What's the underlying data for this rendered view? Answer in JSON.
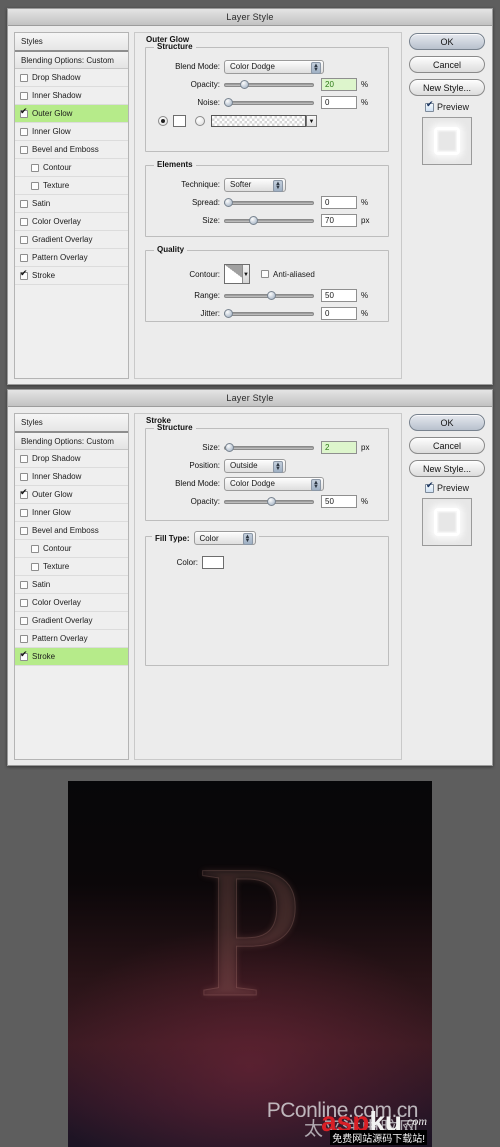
{
  "window": {
    "background_color": "#5e5e5e"
  },
  "dialogs": [
    {
      "title": "Layer Style",
      "styles_panel": {
        "header": "Styles",
        "blending_options": "Blending Options: Custom",
        "items": [
          {
            "label": "Drop Shadow",
            "checked": false,
            "selected": false,
            "indent": false
          },
          {
            "label": "Inner Shadow",
            "checked": false,
            "selected": false,
            "indent": false
          },
          {
            "label": "Outer Glow",
            "checked": true,
            "selected": true,
            "indent": false
          },
          {
            "label": "Inner Glow",
            "checked": false,
            "selected": false,
            "indent": false
          },
          {
            "label": "Bevel and Emboss",
            "checked": false,
            "selected": false,
            "indent": false
          },
          {
            "label": "Contour",
            "checked": false,
            "selected": false,
            "indent": true
          },
          {
            "label": "Texture",
            "checked": false,
            "selected": false,
            "indent": true
          },
          {
            "label": "Satin",
            "checked": false,
            "selected": false,
            "indent": false
          },
          {
            "label": "Color Overlay",
            "checked": false,
            "selected": false,
            "indent": false
          },
          {
            "label": "Gradient Overlay",
            "checked": false,
            "selected": false,
            "indent": false
          },
          {
            "label": "Pattern Overlay",
            "checked": false,
            "selected": false,
            "indent": false
          },
          {
            "label": "Stroke",
            "checked": true,
            "selected": false,
            "indent": false
          }
        ]
      },
      "panel_title": "Outer Glow",
      "groups": {
        "structure": {
          "title": "Structure",
          "blend_mode_label": "Blend Mode:",
          "blend_mode_value": "Color Dodge",
          "opacity_label": "Opacity:",
          "opacity_value": "20",
          "opacity_unit": "%",
          "opacity_percent": 20,
          "noise_label": "Noise:",
          "noise_value": "0",
          "noise_unit": "%",
          "noise_percent": 0,
          "fill_mode": "color",
          "color_swatch": "#ffffff"
        },
        "elements": {
          "title": "Elements",
          "technique_label": "Technique:",
          "technique_value": "Softer",
          "spread_label": "Spread:",
          "spread_value": "0",
          "spread_unit": "%",
          "spread_percent": 0,
          "size_label": "Size:",
          "size_value": "70",
          "size_unit": "px",
          "size_percent": 28
        },
        "quality": {
          "title": "Quality",
          "contour_label": "Contour:",
          "anti_aliased_label": "Anti-aliased",
          "anti_aliased_checked": false,
          "range_label": "Range:",
          "range_value": "50",
          "range_unit": "%",
          "range_percent": 50,
          "jitter_label": "Jitter:",
          "jitter_value": "0",
          "jitter_unit": "%",
          "jitter_percent": 0
        }
      },
      "buttons": {
        "ok": "OK",
        "cancel": "Cancel",
        "new_style": "New Style...",
        "preview": "Preview",
        "preview_checked": true
      }
    },
    {
      "title": "Layer Style",
      "styles_panel": {
        "header": "Styles",
        "blending_options": "Blending Options: Custom",
        "items": [
          {
            "label": "Drop Shadow",
            "checked": false,
            "selected": false,
            "indent": false
          },
          {
            "label": "Inner Shadow",
            "checked": false,
            "selected": false,
            "indent": false
          },
          {
            "label": "Outer Glow",
            "checked": true,
            "selected": false,
            "indent": false
          },
          {
            "label": "Inner Glow",
            "checked": false,
            "selected": false,
            "indent": false
          },
          {
            "label": "Bevel and Emboss",
            "checked": false,
            "selected": false,
            "indent": false
          },
          {
            "label": "Contour",
            "checked": false,
            "selected": false,
            "indent": true
          },
          {
            "label": "Texture",
            "checked": false,
            "selected": false,
            "indent": true
          },
          {
            "label": "Satin",
            "checked": false,
            "selected": false,
            "indent": false
          },
          {
            "label": "Color Overlay",
            "checked": false,
            "selected": false,
            "indent": false
          },
          {
            "label": "Gradient Overlay",
            "checked": false,
            "selected": false,
            "indent": false
          },
          {
            "label": "Pattern Overlay",
            "checked": false,
            "selected": false,
            "indent": false
          },
          {
            "label": "Stroke",
            "checked": true,
            "selected": true,
            "indent": false
          }
        ]
      },
      "panel_title": "Stroke",
      "groups": {
        "structure": {
          "title": "Structure",
          "size_label": "Size:",
          "size_value": "2",
          "size_unit": "px",
          "size_percent": 2,
          "position_label": "Position:",
          "position_value": "Outside",
          "blend_mode_label": "Blend Mode:",
          "blend_mode_value": "Color Dodge",
          "opacity_label": "Opacity:",
          "opacity_value": "50",
          "opacity_unit": "%",
          "opacity_percent": 50
        },
        "fill": {
          "fill_type_label": "Fill Type:",
          "fill_type_value": "Color",
          "color_label": "Color:",
          "color_swatch": "#ffffff"
        }
      },
      "buttons": {
        "ok": "OK",
        "cancel": "Cancel",
        "new_style": "New Style...",
        "preview": "Preview",
        "preview_checked": true
      }
    }
  ],
  "photo": {
    "letter": "P",
    "description": "dark red-purple gradient canvas with glowing outlined letter P"
  },
  "watermarks": {
    "pconline": "PConline.com.cn",
    "pconline_cn": "太平洋电脑网",
    "aspku_red": "asp",
    "aspku_white": "ku",
    "aspku_dotcom": ".com",
    "aspku_sub": "免费网站源码下载站!"
  }
}
